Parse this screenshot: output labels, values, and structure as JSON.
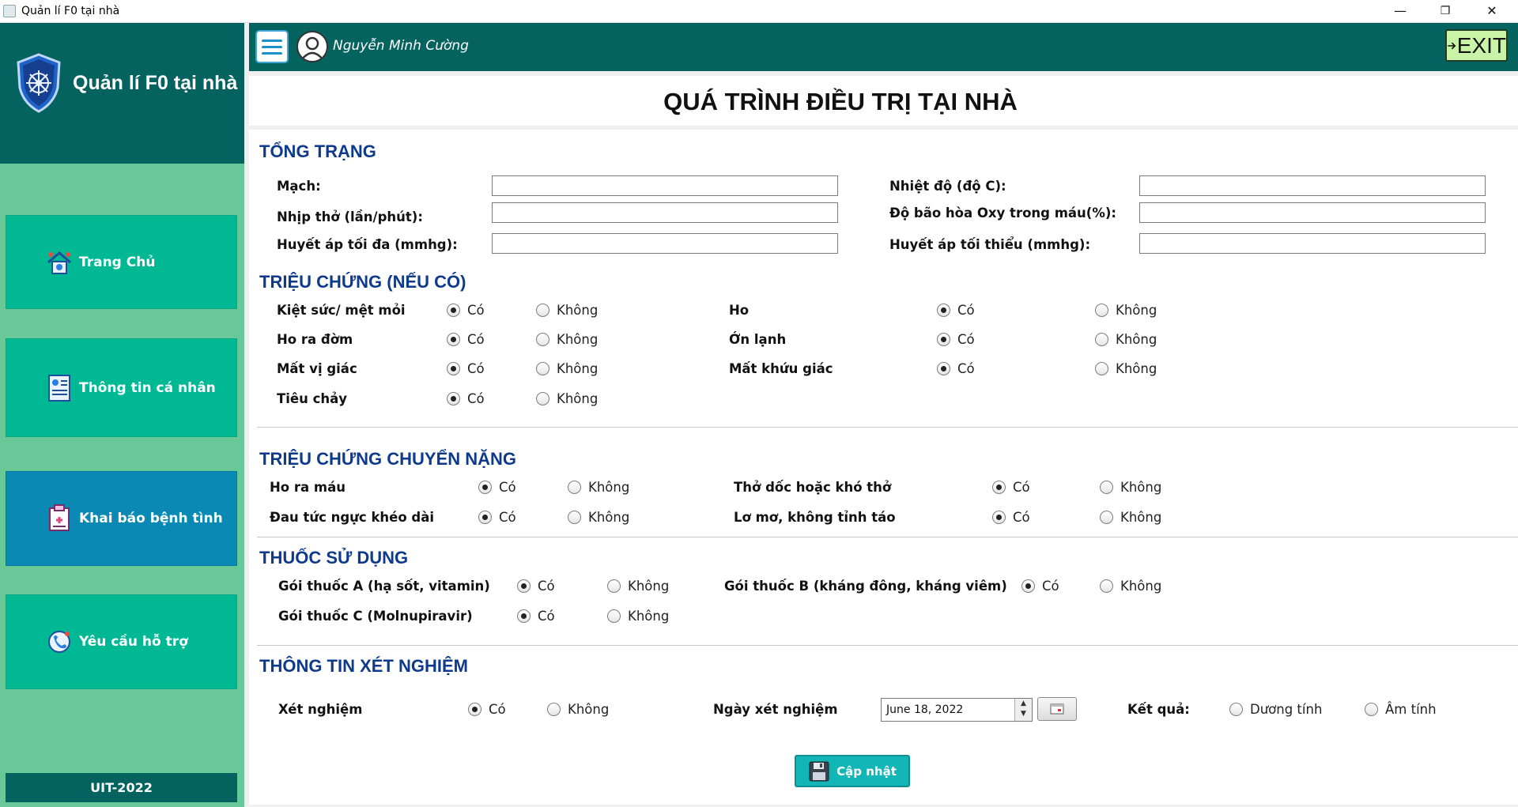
{
  "window": {
    "title": "Quản lí F0 tại nhà",
    "minimize": "—",
    "maximize": "❐",
    "close": "✕"
  },
  "sidebar": {
    "brand": "Quản lí F0 tại nhà",
    "items": [
      {
        "label": "Trang Chủ",
        "icon": "home-icon"
      },
      {
        "label": "Thông tin cá nhân",
        "icon": "profile-icon"
      },
      {
        "label": "Khai báo bệnh tình",
        "icon": "medical-report-icon",
        "active": true
      },
      {
        "label": "Yêu cầu hỗ trợ",
        "icon": "support-icon"
      }
    ],
    "footer": "UIT-2022"
  },
  "header": {
    "username": "Nguyễn Minh Cường",
    "exit_label": "EXIT"
  },
  "page": {
    "title": "QUÁ TRÌNH ĐIỀU TRỊ TẠI NHÀ"
  },
  "sections": {
    "general": {
      "title": "TỔNG TRẠNG",
      "fields": [
        {
          "label": "Mạch:",
          "value": ""
        },
        {
          "label": "Nhịp thở (lần/phút):",
          "value": ""
        },
        {
          "label": "Huyết áp tối đa (mmhg):",
          "value": ""
        },
        {
          "label": "Nhiệt độ (độ C):",
          "value": ""
        },
        {
          "label": "Độ bão hòa Oxy trong máu(%):",
          "value": ""
        },
        {
          "label": "Huyết áp tối thiểu (mmhg):",
          "value": ""
        }
      ]
    },
    "symptoms": {
      "title": "TRIỆU CHỨNG (NẾU CÓ)",
      "items": [
        {
          "label": "Kiệt sức/ mệt mỏi",
          "selected": "yes"
        },
        {
          "label": "Ho ra đờm",
          "selected": "yes"
        },
        {
          "label": "Mất vị giác",
          "selected": "yes"
        },
        {
          "label": "Tiêu chảy",
          "selected": "yes"
        },
        {
          "label": "Ho",
          "selected": "yes"
        },
        {
          "label": "Ớn lạnh",
          "selected": "yes"
        },
        {
          "label": "Mất khứu giác",
          "selected": "yes"
        }
      ]
    },
    "severe": {
      "title": "TRIỆU CHỨNG CHUYỂN NẶNG",
      "items": [
        {
          "label": "Ho ra máu",
          "selected": "yes"
        },
        {
          "label": "Đau tức ngực khéo dài",
          "selected": "yes"
        },
        {
          "label": "Thở dốc hoặc khó thở",
          "selected": "yes"
        },
        {
          "label": "Lơ mơ, không tỉnh táo",
          "selected": "yes"
        }
      ]
    },
    "medicine": {
      "title": "THUỐC SỬ DỤNG",
      "items": [
        {
          "label": "Gói thuốc A (hạ sốt, vitamin)",
          "selected": "yes"
        },
        {
          "label": "Gói thuốc C (Molnupiravir)",
          "selected": "yes"
        },
        {
          "label": "Gói thuốc B (kháng đông, kháng viêm)",
          "selected": "yes"
        }
      ]
    },
    "test": {
      "title": "THÔNG TIN XÉT NGHIỆM",
      "test_label": "Xét nghiệm",
      "test_selected": "yes",
      "date_label": "Ngày xét nghiệm",
      "date_value": "June 18, 2022",
      "result_label": "Kết quả:",
      "result_options": [
        "Dương tính",
        "Âm tính"
      ],
      "result_selected": ""
    }
  },
  "options": {
    "yes": "Có",
    "no": "Không"
  },
  "save_label": "Cập nhật"
}
